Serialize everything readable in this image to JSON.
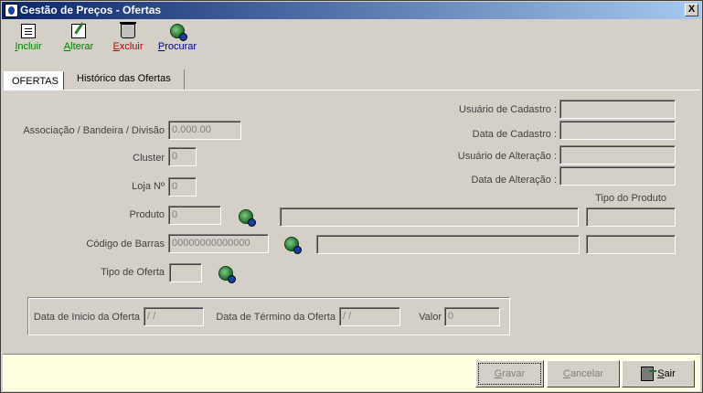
{
  "window": {
    "title": "Gestão de Preços - Ofertas",
    "close_glyph": "X"
  },
  "toolbar": {
    "incluir": {
      "underline": "I",
      "rest": "ncluir",
      "color": "#008000",
      "icon": "new-document-icon"
    },
    "alterar": {
      "underline": "A",
      "rest": "lterar",
      "color": "#008000",
      "icon": "edit-document-icon"
    },
    "excluir": {
      "underline": "E",
      "rest": "xcluir",
      "color": "#c00000",
      "icon": "trash-icon"
    },
    "procurar": {
      "underline": "P",
      "rest": "rocurar",
      "color": "#000080",
      "icon": "search-icon"
    }
  },
  "tabs": [
    {
      "label": "OFERTAS",
      "active": true
    },
    {
      "label": "Histórico das Ofertas",
      "active": false
    }
  ],
  "form": {
    "associacao": {
      "label": "Associação / Bandeira / Divisão",
      "value": "0.000.00"
    },
    "cluster": {
      "label": "Cluster",
      "value": "0"
    },
    "loja": {
      "label": "Loja Nº",
      "value": "0"
    },
    "produto": {
      "label": "Produto",
      "value": "0",
      "description": ""
    },
    "codigo_barras": {
      "label": "Código de Barras",
      "value": "00000000000000",
      "description": ""
    },
    "tipo_oferta": {
      "label": "Tipo de Oferta",
      "value": ""
    },
    "usuario_cadastro": {
      "label": "Usuário de Cadastro :",
      "value": ""
    },
    "data_cadastro": {
      "label": "Data de Cadastro :",
      "value": ""
    },
    "usuario_alteracao": {
      "label": "Usuário de Alteração :",
      "value": ""
    },
    "data_alteracao": {
      "label": "Data de Alteração :",
      "value": ""
    },
    "tipo_produto": {
      "label": "Tipo do Produto",
      "value1": "",
      "value2": ""
    },
    "data_inicio": {
      "label": "Data de Inicio da Oferta",
      "value": " /  /"
    },
    "data_termino": {
      "label": "Data de Término da Oferta",
      "value": " /  /"
    },
    "valor": {
      "label": "Valor",
      "value": "0"
    }
  },
  "footer": {
    "gravar": {
      "underline": "G",
      "rest": "ravar"
    },
    "cancelar": {
      "underline": "C",
      "rest": "ancelar"
    },
    "sair": {
      "underline": "S",
      "rest": "air",
      "icon": "exit-door-icon"
    }
  }
}
